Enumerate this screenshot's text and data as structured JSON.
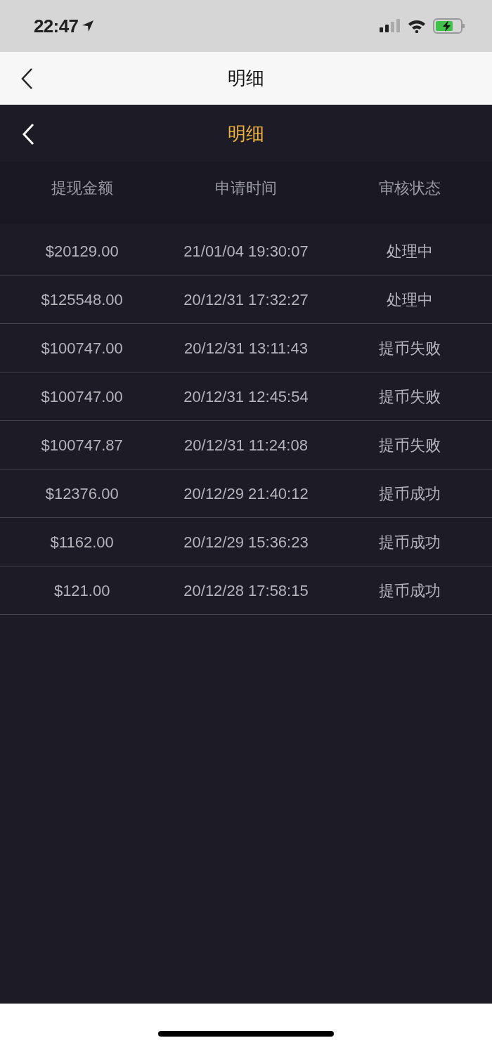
{
  "status_bar": {
    "time": "22:47"
  },
  "nav_bar": {
    "title": "明细"
  },
  "page_header": {
    "title": "明细"
  },
  "table": {
    "columns": [
      "提现金额",
      "申请时间",
      "审核状态"
    ],
    "rows": [
      {
        "amount": "$20129.00",
        "time": "21/01/04 19:30:07",
        "status": "处理中"
      },
      {
        "amount": "$125548.00",
        "time": "20/12/31 17:32:27",
        "status": "处理中"
      },
      {
        "amount": "$100747.00",
        "time": "20/12/31 13:11:43",
        "status": "提币失败"
      },
      {
        "amount": "$100747.00",
        "time": "20/12/31 12:45:54",
        "status": "提币失败"
      },
      {
        "amount": "$100747.87",
        "time": "20/12/31 11:24:08",
        "status": "提币失败"
      },
      {
        "amount": "$12376.00",
        "time": "20/12/29 21:40:12",
        "status": "提币成功"
      },
      {
        "amount": "$1162.00",
        "time": "20/12/29 15:36:23",
        "status": "提币成功"
      },
      {
        "amount": "$121.00",
        "time": "20/12/28 17:58:15",
        "status": "提币成功"
      }
    ]
  }
}
